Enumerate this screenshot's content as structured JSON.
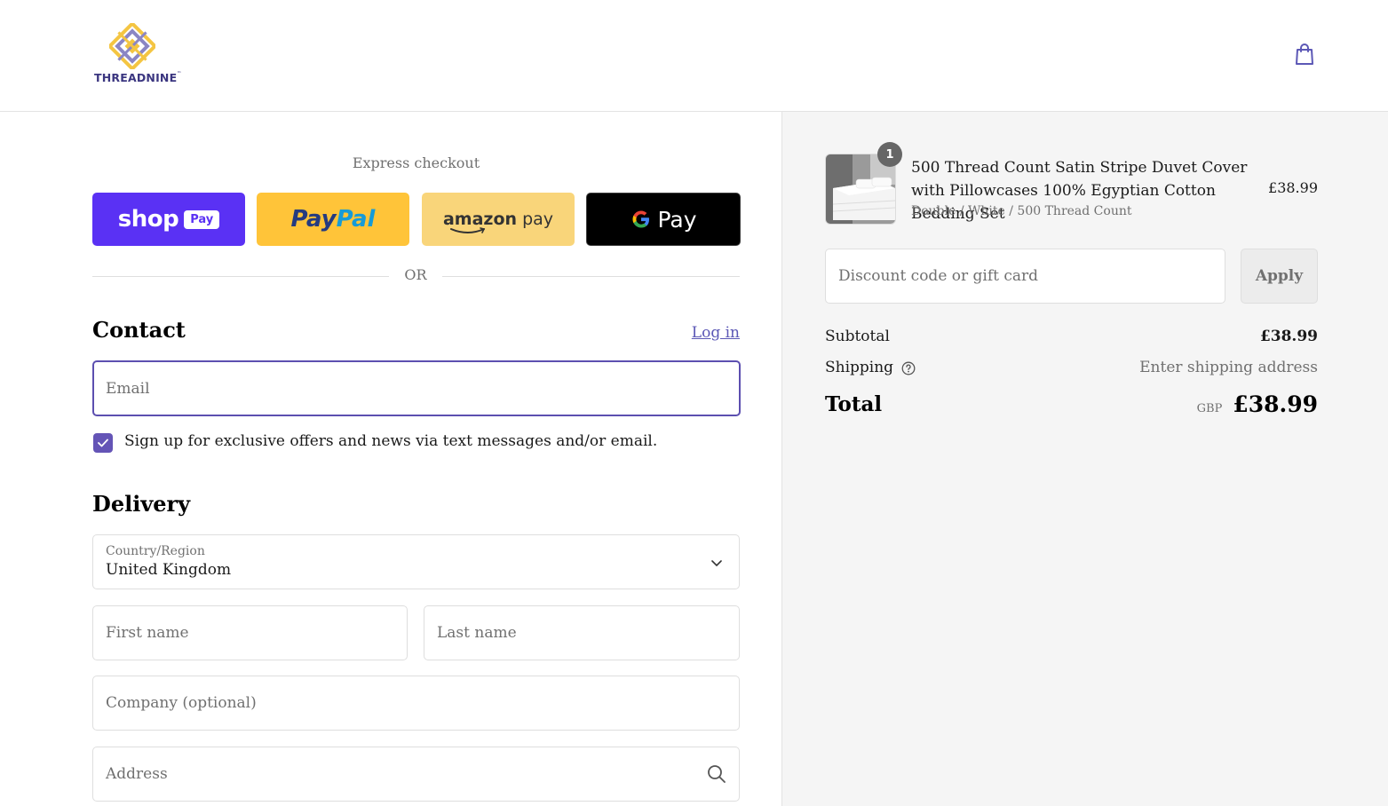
{
  "brand": {
    "name": "THREADNINE",
    "trademark": "™"
  },
  "express": {
    "title": "Express checkout",
    "shoppay": {
      "shop": "shop",
      "pay": "Pay"
    },
    "paypal": {
      "pay": "Pay",
      "pal": "Pal"
    },
    "amazonpay": {
      "amazon": "amazon",
      "pay": "pay"
    },
    "gpay": {
      "g": "G",
      "pay": "Pay"
    },
    "or": "OR"
  },
  "contact": {
    "heading": "Contact",
    "login": "Log in",
    "email_placeholder": "Email",
    "marketing_label": "Sign up for exclusive offers and news via text messages and/or email.",
    "marketing_checked": true
  },
  "delivery": {
    "heading": "Delivery",
    "country_label": "Country/Region",
    "country_value": "United Kingdom",
    "first_name_placeholder": "First name",
    "last_name_placeholder": "Last name",
    "company_placeholder": "Company (optional)",
    "address_placeholder": "Address"
  },
  "summary": {
    "product": {
      "quantity": "1",
      "title": "500 Thread Count Satin Stripe Duvet Cover with Pillowcases 100% Egyptian Cotton Bedding Set",
      "variant": "Double / White / 500 Thread Count",
      "price": "£38.99"
    },
    "discount_placeholder": "Discount code or gift card",
    "apply": "Apply",
    "subtotal_label": "Subtotal",
    "subtotal_value": "£38.99",
    "shipping_label": "Shipping",
    "shipping_value": "Enter shipping address",
    "total_label": "Total",
    "currency": "GBP",
    "total_value": "£38.99"
  },
  "colors": {
    "accent": "#5c4fb0",
    "shoppay": "#5a31f4",
    "paypal": "#ffc439",
    "amazonpay": "#f9d57a",
    "gpay": "#000000"
  }
}
